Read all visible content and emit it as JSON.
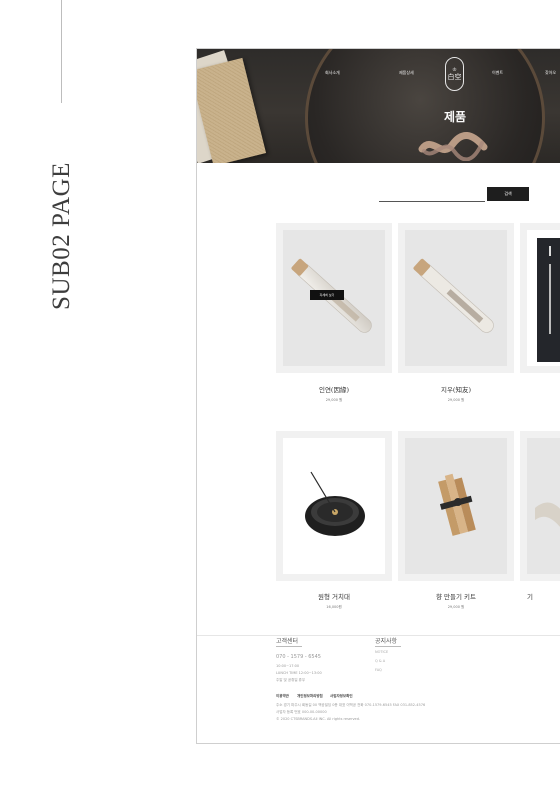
{
  "page_label": "SUB02 PAGE",
  "nav": {
    "items": [
      {
        "label": "회사소개"
      },
      {
        "label": "제품상세"
      },
      {
        "label": "이벤트"
      },
      {
        "label": "찾아오"
      }
    ],
    "logo_text": "白空"
  },
  "hero": {
    "title": "제품"
  },
  "search": {
    "button_label": "검색"
  },
  "overlay": {
    "detail_label": "자세히 보기"
  },
  "products": [
    {
      "name": "인연(因緣)",
      "price": "29,000 원"
    },
    {
      "name": "지우(知友)",
      "price": "29,000 원"
    },
    {
      "name": "",
      "price": ""
    },
    {
      "name": "원형 거치대",
      "price": "16,000원"
    },
    {
      "name": "향 만들기 키트",
      "price": "29,000 원"
    },
    {
      "name": "기",
      "price": ""
    }
  ],
  "footer": {
    "cs_title": "고객센터",
    "phone": "070 - 1579 - 6545",
    "hours": "10:00~17:00",
    "lunch": "LUNCH TIME 12:00~13:00",
    "holiday": "주말 및 공휴일 휴무",
    "notice_title": "공지사항",
    "notice_items": [
      "NOTICE",
      "Q & A",
      "FAQ"
    ],
    "links": [
      "이용약관",
      "개인정보처리방침",
      "사업자정보확인"
    ],
    "address": "주소 경기 파주시 회동길 00 백공빌딩 0층    대표 이백공    전화 070-1579-6545    FAX 031-852-4576",
    "biz": "사업자 등록 번호 000-00-00000",
    "copyright": "© 2020 CTSBRANDS.All INC. All rights reserved."
  }
}
